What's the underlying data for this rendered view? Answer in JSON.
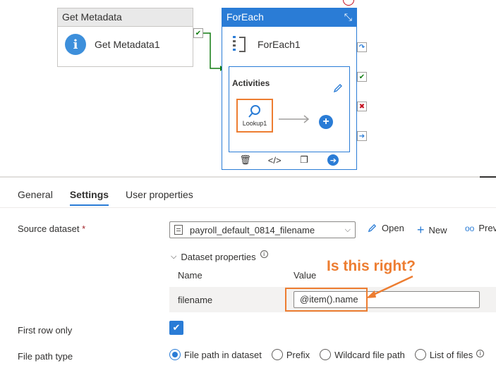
{
  "canvas": {
    "get_metadata": {
      "header": "Get Metadata",
      "name": "Get Metadata1"
    },
    "foreach": {
      "header": "ForEach",
      "name": "ForEach1",
      "activities_label": "Activities",
      "inner_activity": "Lookup1"
    }
  },
  "tabs": [
    {
      "label": "General"
    },
    {
      "label": "Settings",
      "active": true
    },
    {
      "label": "User properties"
    }
  ],
  "settings": {
    "source_dataset_label": "Source dataset",
    "required_marker": "*",
    "source_dataset_value": "payroll_default_0814_filename",
    "open_label": "Open",
    "new_label": "New",
    "preview_label": "Prev",
    "dataset_properties_label": "Dataset properties",
    "col_name": "Name",
    "col_value": "Value",
    "param_name": "filename",
    "param_value": "@item().name",
    "first_row_only_label": "First row only",
    "first_row_only_checked": true,
    "file_path_type_label": "File path type",
    "file_path_options": [
      {
        "label": "File path in dataset",
        "selected": true
      },
      {
        "label": "Prefix",
        "selected": false
      },
      {
        "label": "Wildcard file path",
        "selected": false
      },
      {
        "label": "List of files",
        "selected": false
      }
    ]
  },
  "annotation": {
    "text": "Is this right?",
    "color": "#ed7d31"
  },
  "colors": {
    "accent": "#2a7cd6",
    "highlight": "#ed7d31",
    "success": "#107c10",
    "danger": "#c50f1f"
  }
}
